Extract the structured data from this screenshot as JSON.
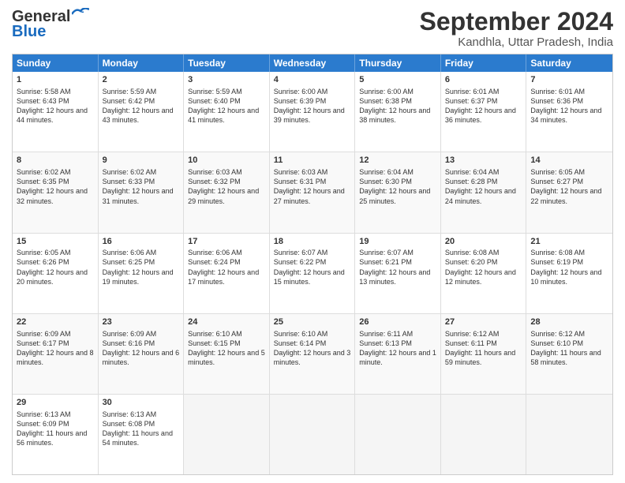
{
  "title": "September 2024",
  "subtitle": "Kandhla, Uttar Pradesh, India",
  "logo": {
    "line1": "General",
    "line2": "Blue"
  },
  "headers": [
    "Sunday",
    "Monday",
    "Tuesday",
    "Wednesday",
    "Thursday",
    "Friday",
    "Saturday"
  ],
  "rows": [
    [
      {
        "empty": true
      },
      {
        "empty": true
      },
      {
        "empty": true
      },
      {
        "empty": true
      },
      {
        "empty": true
      },
      {
        "empty": true
      },
      {
        "empty": true
      }
    ]
  ],
  "days": [
    {
      "date": "1",
      "sunrise": "5:58 AM",
      "sunset": "6:43 PM",
      "daylight": "12 hours and 44 minutes."
    },
    {
      "date": "2",
      "sunrise": "5:59 AM",
      "sunset": "6:42 PM",
      "daylight": "12 hours and 43 minutes."
    },
    {
      "date": "3",
      "sunrise": "5:59 AM",
      "sunset": "6:40 PM",
      "daylight": "12 hours and 41 minutes."
    },
    {
      "date": "4",
      "sunrise": "6:00 AM",
      "sunset": "6:39 PM",
      "daylight": "12 hours and 39 minutes."
    },
    {
      "date": "5",
      "sunrise": "6:00 AM",
      "sunset": "6:38 PM",
      "daylight": "12 hours and 38 minutes."
    },
    {
      "date": "6",
      "sunrise": "6:01 AM",
      "sunset": "6:37 PM",
      "daylight": "12 hours and 36 minutes."
    },
    {
      "date": "7",
      "sunrise": "6:01 AM",
      "sunset": "6:36 PM",
      "daylight": "12 hours and 34 minutes."
    },
    {
      "date": "8",
      "sunrise": "6:02 AM",
      "sunset": "6:35 PM",
      "daylight": "12 hours and 32 minutes."
    },
    {
      "date": "9",
      "sunrise": "6:02 AM",
      "sunset": "6:33 PM",
      "daylight": "12 hours and 31 minutes."
    },
    {
      "date": "10",
      "sunrise": "6:03 AM",
      "sunset": "6:32 PM",
      "daylight": "12 hours and 29 minutes."
    },
    {
      "date": "11",
      "sunrise": "6:03 AM",
      "sunset": "6:31 PM",
      "daylight": "12 hours and 27 minutes."
    },
    {
      "date": "12",
      "sunrise": "6:04 AM",
      "sunset": "6:30 PM",
      "daylight": "12 hours and 25 minutes."
    },
    {
      "date": "13",
      "sunrise": "6:04 AM",
      "sunset": "6:28 PM",
      "daylight": "12 hours and 24 minutes."
    },
    {
      "date": "14",
      "sunrise": "6:05 AM",
      "sunset": "6:27 PM",
      "daylight": "12 hours and 22 minutes."
    },
    {
      "date": "15",
      "sunrise": "6:05 AM",
      "sunset": "6:26 PM",
      "daylight": "12 hours and 20 minutes."
    },
    {
      "date": "16",
      "sunrise": "6:06 AM",
      "sunset": "6:25 PM",
      "daylight": "12 hours and 19 minutes."
    },
    {
      "date": "17",
      "sunrise": "6:06 AM",
      "sunset": "6:24 PM",
      "daylight": "12 hours and 17 minutes."
    },
    {
      "date": "18",
      "sunrise": "6:07 AM",
      "sunset": "6:22 PM",
      "daylight": "12 hours and 15 minutes."
    },
    {
      "date": "19",
      "sunrise": "6:07 AM",
      "sunset": "6:21 PM",
      "daylight": "12 hours and 13 minutes."
    },
    {
      "date": "20",
      "sunrise": "6:08 AM",
      "sunset": "6:20 PM",
      "daylight": "12 hours and 12 minutes."
    },
    {
      "date": "21",
      "sunrise": "6:08 AM",
      "sunset": "6:19 PM",
      "daylight": "12 hours and 10 minutes."
    },
    {
      "date": "22",
      "sunrise": "6:09 AM",
      "sunset": "6:17 PM",
      "daylight": "12 hours and 8 minutes."
    },
    {
      "date": "23",
      "sunrise": "6:09 AM",
      "sunset": "6:16 PM",
      "daylight": "12 hours and 6 minutes."
    },
    {
      "date": "24",
      "sunrise": "6:10 AM",
      "sunset": "6:15 PM",
      "daylight": "12 hours and 5 minutes."
    },
    {
      "date": "25",
      "sunrise": "6:10 AM",
      "sunset": "6:14 PM",
      "daylight": "12 hours and 3 minutes."
    },
    {
      "date": "26",
      "sunrise": "6:11 AM",
      "sunset": "6:13 PM",
      "daylight": "12 hours and 1 minute."
    },
    {
      "date": "27",
      "sunrise": "6:12 AM",
      "sunset": "6:11 PM",
      "daylight": "11 hours and 59 minutes."
    },
    {
      "date": "28",
      "sunrise": "6:12 AM",
      "sunset": "6:10 PM",
      "daylight": "11 hours and 58 minutes."
    },
    {
      "date": "29",
      "sunrise": "6:13 AM",
      "sunset": "6:09 PM",
      "daylight": "11 hours and 56 minutes."
    },
    {
      "date": "30",
      "sunrise": "6:13 AM",
      "sunset": "6:08 PM",
      "daylight": "11 hours and 54 minutes."
    }
  ]
}
